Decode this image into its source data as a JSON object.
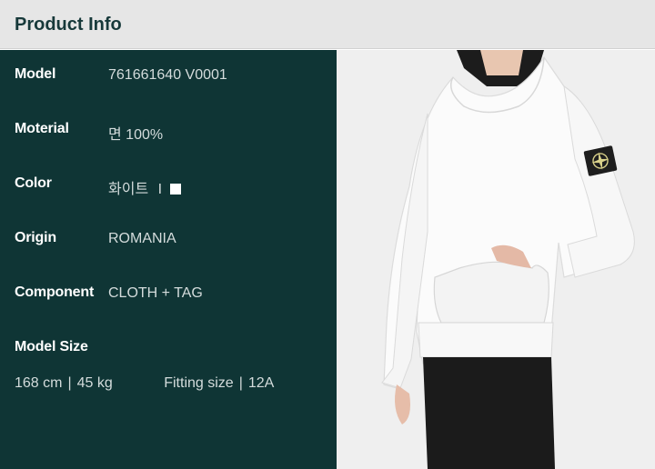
{
  "header": {
    "title": "Product Info"
  },
  "info": {
    "model": {
      "label": "Model",
      "value": "761661640 V0001"
    },
    "material": {
      "label": "Moterial",
      "value": "면 100%"
    },
    "color": {
      "label": "Color",
      "value": "화이트",
      "divider": "I",
      "swatch_color": "#ffffff"
    },
    "origin": {
      "label": "Origin",
      "value": "ROMANIA"
    },
    "component": {
      "label": "Component",
      "value": "CLOTH + TAG"
    },
    "model_size": {
      "label": "Model Size",
      "height": "168 cm",
      "weight": "45 kg",
      "fitting_label": "Fitting size",
      "fitting_value": "12A",
      "separator": "|"
    }
  },
  "photo": {
    "subject": "model wearing white hoodie with compass badge",
    "icon": "compass-badge-icon"
  },
  "colors": {
    "header_bg": "#e6e6e6",
    "title": "#17393a",
    "panel_bg": "#0f3535",
    "text": "#ffffff",
    "muted": "#d4dcdc"
  }
}
